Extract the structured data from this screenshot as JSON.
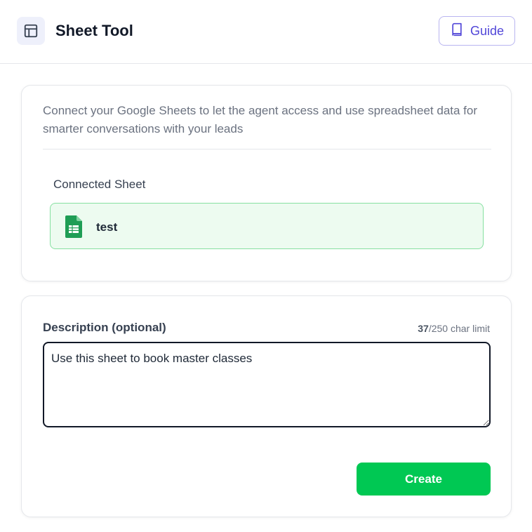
{
  "header": {
    "title": "Sheet Tool",
    "app_icon": "table-icon",
    "guide_label": "Guide",
    "guide_icon": "book-icon"
  },
  "connection": {
    "intro": "Connect your Google Sheets to let the agent access and use spreadsheet data for smarter conversations with your leads",
    "connected_label": "Connected Sheet",
    "sheet": {
      "name": "test",
      "icon": "google-sheets-icon"
    }
  },
  "description": {
    "label": "Description (optional)",
    "count": "37",
    "limit": "/250 char limit",
    "value": "Use this sheet to book master classes"
  },
  "actions": {
    "create_label": "Create"
  },
  "colors": {
    "accent": "#5146d8",
    "success_bg": "#edfbf0",
    "success_border": "#86e0a0",
    "primary_button": "#00c853",
    "sheets_green": "#1f9d55"
  }
}
